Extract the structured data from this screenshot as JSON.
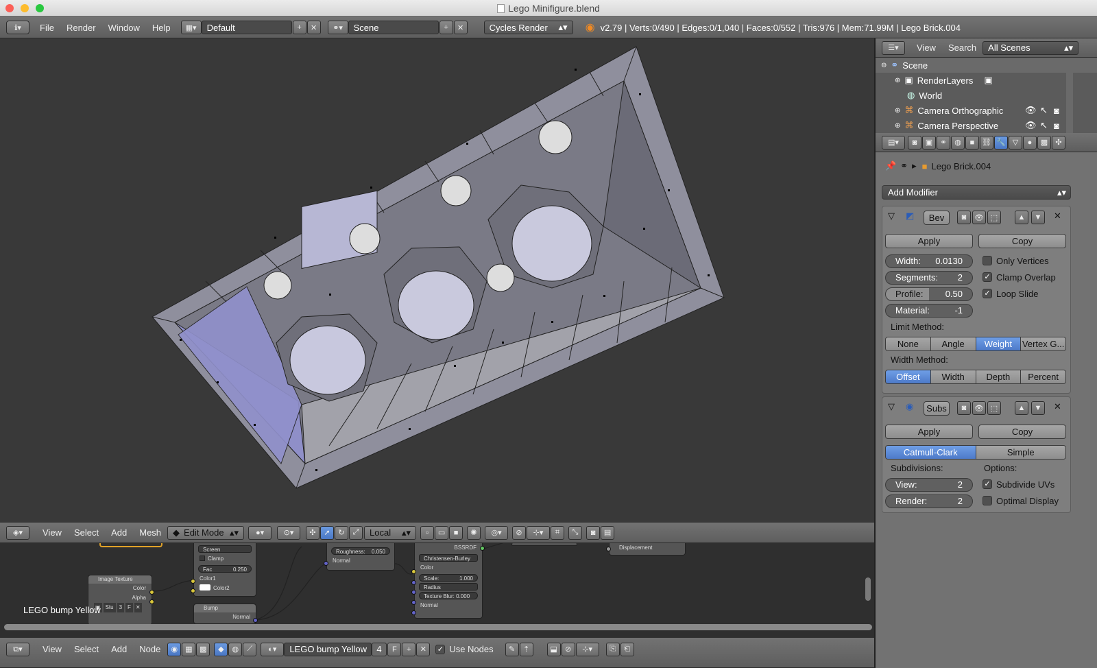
{
  "window": {
    "title": "Lego Minifigure.blend"
  },
  "top": {
    "menu": [
      "File",
      "Render",
      "Window",
      "Help"
    ],
    "screen": "Default",
    "scene": "Scene",
    "engine": "Cycles Render",
    "stats": "v2.79 | Verts:0/490 | Edges:0/1,040 | Faces:0/552 | Tris:976 | Mem:71.99M | Lego Brick.004"
  },
  "outliner": {
    "menu": [
      "View",
      "Search"
    ],
    "filter": "All Scenes",
    "items": [
      "Scene",
      "RenderLayers",
      "World",
      "Camera Orthographic",
      "Camera Perspective"
    ]
  },
  "props": {
    "object": "Lego Brick.004",
    "add_modifier": "Add Modifier",
    "bevel": {
      "name": "Bev",
      "apply": "Apply",
      "copy": "Copy",
      "width_label": "Width:",
      "width": "0.0130",
      "segments_label": "Segments:",
      "segments": "2",
      "profile_label": "Profile:",
      "profile": "0.50",
      "material_label": "Material:",
      "material": "-1",
      "only_vertices": "Only Vertices",
      "clamp_overlap": "Clamp Overlap",
      "loop_slide": "Loop Slide",
      "limit_method": "Limit Method:",
      "limit_opts": [
        "None",
        "Angle",
        "Weight",
        "Vertex G..."
      ],
      "width_method": "Width Method:",
      "width_opts": [
        "Offset",
        "Width",
        "Depth",
        "Percent"
      ]
    },
    "subsurf": {
      "name": "Subs",
      "apply": "Apply",
      "copy": "Copy",
      "types": [
        "Catmull-Clark",
        "Simple"
      ],
      "subdivisions": "Subdivisions:",
      "options": "Options:",
      "view_label": "View:",
      "view": "2",
      "render_label": "Render:",
      "render": "2",
      "subdivide_uvs": "Subdivide UVs",
      "optimal_display": "Optimal Display"
    }
  },
  "view3d": {
    "menu": [
      "View",
      "Select",
      "Add",
      "Mesh"
    ],
    "mode": "Edit Mode",
    "orientation": "Local"
  },
  "nodes": {
    "menu": [
      "View",
      "Select",
      "Add",
      "Node"
    ],
    "material": "LEGO bump Yellow",
    "users": "4",
    "fake": "F",
    "use_nodes": "Use Nodes",
    "overlay_label": "LEGO bump Yellow",
    "n_image": "Image Texture",
    "n_image_out": [
      "Color",
      "Alpha"
    ],
    "n_image_fields": [
      "Stu",
      "3",
      "F"
    ],
    "n_mix_screen": "Screen",
    "n_mix_clamp": "Clamp",
    "n_mix_fac": "Fac",
    "n_mix_fac_val": "0.250",
    "n_mix_in": [
      "Color1",
      "Color2"
    ],
    "n_bump": "Bump",
    "n_bump_out": "Normal",
    "n_rough": "Roughness:",
    "n_rough_val": "0.050",
    "n_normal": "Normal",
    "n_bssrdf": "BSSRDF",
    "n_bssrdf_mode": "Christensen-Burley",
    "n_bssrdf_color": "Color",
    "n_scale": "Scale:",
    "n_scale_val": "1.000",
    "n_radius": "Radius",
    "n_blur": "Texture Blur: 0.000",
    "n_bssrdf_normal": "Normal",
    "n_disp": "Displacement"
  }
}
